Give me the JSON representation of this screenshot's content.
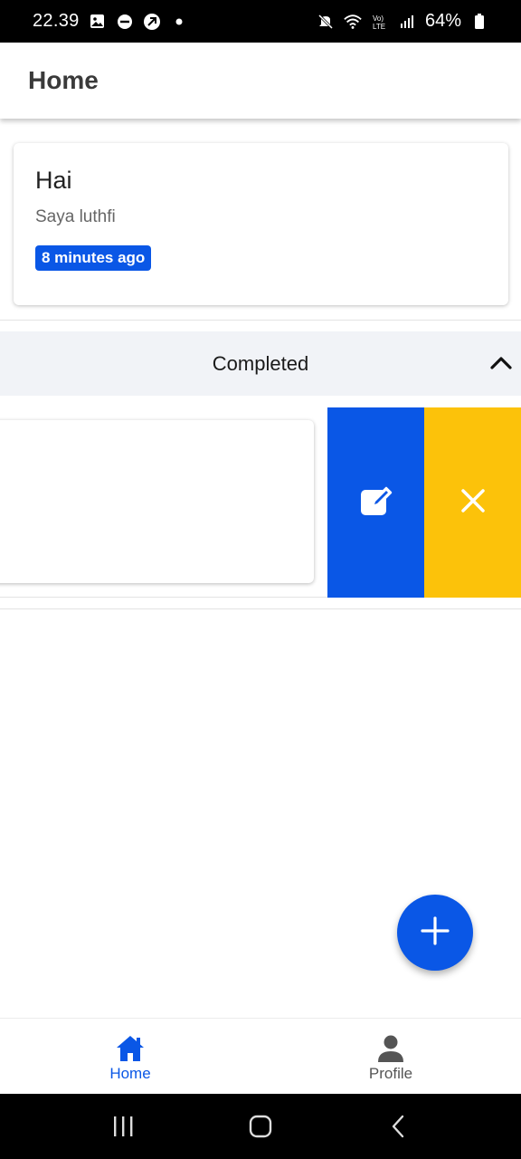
{
  "status_bar": {
    "time": "22.39",
    "battery": "64%",
    "icons": [
      "gallery-icon",
      "dnd-icon",
      "vpn-icon",
      "dot-icon",
      "mute-icon",
      "wifi-icon",
      "volte-icon",
      "signal-icon",
      "battery-icon"
    ]
  },
  "app_bar": {
    "title": "Home"
  },
  "task": {
    "title": "Hai",
    "description": "Saya luthfi",
    "time_badge": "8 minutes ago"
  },
  "completed_section": {
    "label": "Completed",
    "expanded": true
  },
  "swipe_actions": {
    "edit_color": "#0a57e6",
    "delete_color": "#fcc20a",
    "edit_icon": "edit-icon",
    "delete_icon": "close-icon"
  },
  "fab": {
    "icon": "plus-icon",
    "color": "#0a57e6"
  },
  "bottom_nav": {
    "items": [
      {
        "label": "Home",
        "icon": "home-icon",
        "active": true
      },
      {
        "label": "Profile",
        "icon": "person-icon",
        "active": false
      }
    ]
  },
  "colors": {
    "accent": "#0a57e6",
    "warning": "#fcc20a"
  }
}
